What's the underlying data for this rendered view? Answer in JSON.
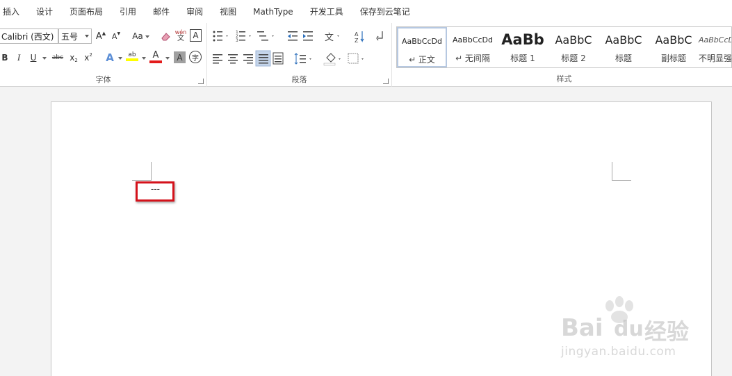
{
  "menu": {
    "tabs": [
      "插入",
      "设计",
      "页面布局",
      "引用",
      "邮件",
      "审阅",
      "视图",
      "MathType",
      "开发工具",
      "保存到云笔记"
    ]
  },
  "ribbon": {
    "font_group": {
      "label": "字体",
      "font_name": "Calibri (西文)",
      "font_size": "五号",
      "grow_label": "A",
      "shrink_label": "A",
      "case_label": "Aa",
      "wen_label": "wén",
      "wen_sub": "文",
      "border_a_label": "A",
      "bold_label": "B",
      "italic_label": "I",
      "underline_label": "U",
      "strike_label": "abc",
      "sub_label": "x",
      "sub_suffix": "2",
      "sup_label": "x",
      "sup_suffix": "2",
      "effect_label": "A",
      "highlight_label": "ab",
      "fontcolor_label": "A",
      "shading_label": "A",
      "enclose_label": "字"
    },
    "paragraph_group": {
      "label": "段落"
    },
    "styles_group": {
      "label": "样式",
      "styles": [
        {
          "preview": "AaBbCcDd",
          "name": "↵ 正文"
        },
        {
          "preview": "AaBbCcDd",
          "name": "↵ 无间隔"
        },
        {
          "preview": "AaBb",
          "name": "标题 1"
        },
        {
          "preview": "AaBbC",
          "name": "标题 2"
        },
        {
          "preview": "AaBbC",
          "name": "标题"
        },
        {
          "preview": "AaBbC",
          "name": "副标题"
        },
        {
          "preview": "AaBbCcDd",
          "name": "不明显强"
        }
      ]
    }
  },
  "document": {
    "text": "---"
  },
  "watermark": {
    "brand": "Bai",
    "brand2": "du",
    "brand_cn": "经验",
    "url": "jingyan.baidu.com"
  },
  "colors": {
    "highlight_box": "#d4121b",
    "highlight_yellow": "#ffff00",
    "font_red": "#e31b1b"
  }
}
